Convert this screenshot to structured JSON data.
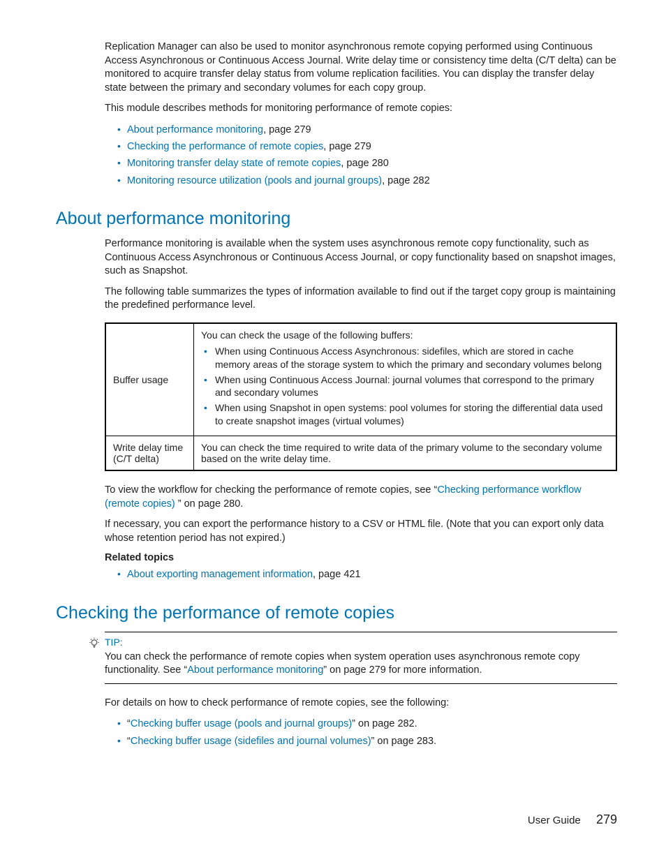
{
  "intro": {
    "p1": "Replication Manager can also be used to monitor asynchronous remote copying performed using Continuous Access Asynchronous or Continuous Access Journal. Write delay time or consistency time delta (C/T delta) can be monitored to acquire transfer delay status from volume replication facilities. You can display the transfer delay state between the primary and secondary volumes for each copy group.",
    "p2": "This module describes methods for monitoring performance of remote copies:"
  },
  "toc": [
    {
      "link": "About performance monitoring",
      "suffix": ", page 279"
    },
    {
      "link": "Checking the performance of remote copies",
      "suffix": ", page 279"
    },
    {
      "link": "Monitoring transfer delay state of remote copies",
      "suffix": ", page 280"
    },
    {
      "link": "Monitoring resource utilization (pools and journal groups)",
      "suffix": ", page 282"
    }
  ],
  "section1": {
    "heading": "About performance monitoring",
    "p1": "Performance monitoring is available when the system uses asynchronous remote copy functionality, such as Continuous Access Asynchronous or Continuous Access Journal, or copy functionality based on snapshot images, such as Snapshot.",
    "p2": "The following table summarizes the types of information available to find out if the target copy group is maintaining the predefined performance level.",
    "table": {
      "row1": {
        "label": "Buffer usage",
        "lead": "You can check the usage of the following buffers:",
        "bullets": [
          "When using Continuous Access Asynchronous: sidefiles, which are stored in cache memory areas of the storage system to which the primary and secondary volumes belong",
          "When using Continuous Access Journal: journal volumes that correspond to the primary and secondary volumes",
          "When using Snapshot in open systems: pool volumes for storing the differential data used to create snapshot images (virtual volumes)"
        ]
      },
      "row2": {
        "label": "Write delay time (C/T delta)",
        "text": "You can check the time required to write data of the primary volume to the secondary volume based on the write delay time."
      }
    },
    "p3_pre": "To view the workflow for checking the performance of remote copies, see “",
    "p3_link": "Checking performance workflow (remote copies)  ",
    "p3_post": "” on page 280.",
    "p4": "If necessary, you can export the performance history to a CSV or HTML file. (Note that you can export only data whose retention period has not expired.)",
    "related_label": "Related topics",
    "related_link": "About exporting management information",
    "related_suffix": ", page 421"
  },
  "section2": {
    "heading": "Checking the performance of remote copies",
    "tip_label": "TIP:",
    "tip_pre": "You can check the performance of remote copies when system operation uses asynchronous remote copy functionality. See “",
    "tip_link": "About performance monitoring",
    "tip_post": "” on page 279 for more information.",
    "p1": "For details on how to check performance of remote copies, see the following:",
    "bullets": [
      {
        "pre": "“",
        "link": "Checking buffer usage (pools and journal groups)",
        "post": "” on page 282."
      },
      {
        "pre": "“",
        "link": "Checking buffer usage (sidefiles and journal volumes)",
        "post": "” on page 283."
      }
    ]
  },
  "footer": {
    "label": "User Guide",
    "page": "279"
  }
}
